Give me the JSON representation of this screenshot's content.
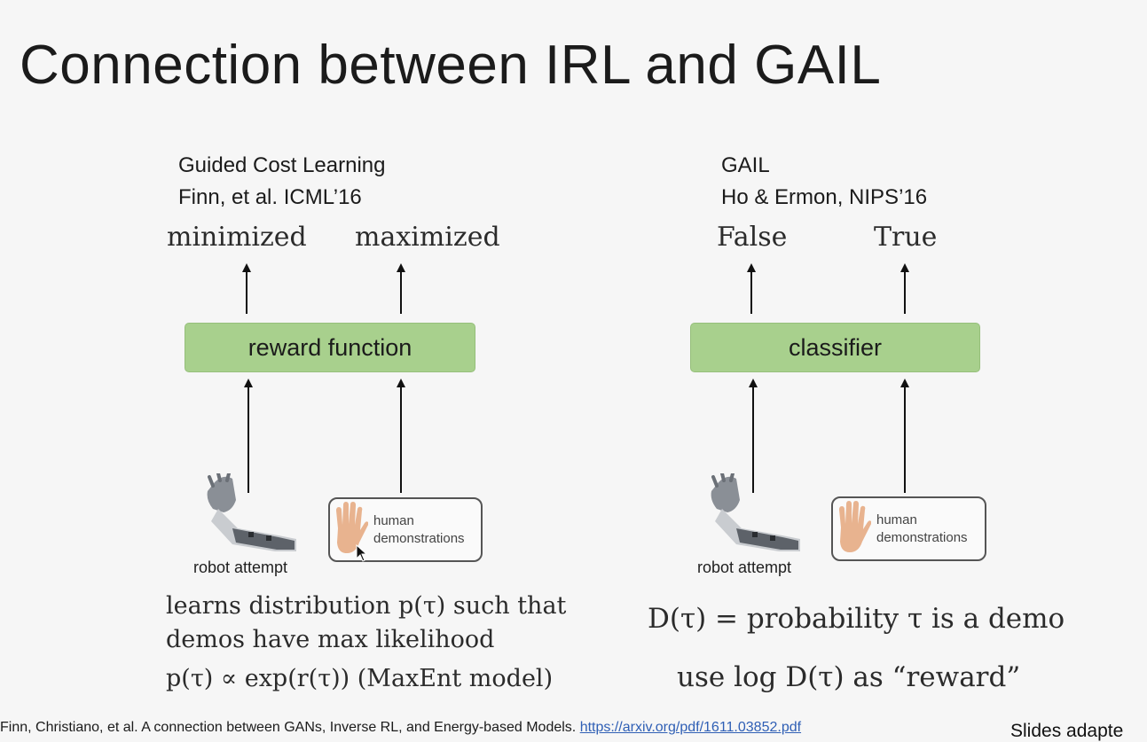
{
  "title": "Connection between IRL and GAIL",
  "left": {
    "head_line1": "Guided Cost Learning",
    "head_line2": "Finn, et al. ICML’16",
    "out_left": "minimized",
    "out_right": "maximized",
    "box_label": "reward function",
    "robot_caption": "robot attempt",
    "demo_line1": "human",
    "demo_line2": "demonstrations",
    "text_line1": "learns distribution p(τ) such that",
    "text_line2": "demos have max likelihood",
    "text_line3": "p(τ) ∝ exp(r(τ)) (MaxEnt model)"
  },
  "right": {
    "head_line1": "GAIL",
    "head_line2": "Ho & Ermon, NIPS’16",
    "out_left": "False",
    "out_right": "True",
    "box_label": "classifier",
    "robot_caption": "robot attempt",
    "demo_line1": "human",
    "demo_line2": "demonstrations",
    "text_line1": "D(τ) = probability τ is a demo",
    "text_line2": "use log D(τ) as “reward”"
  },
  "footer": {
    "citation": "Finn, Christiano, et al. A connection between GANs, Inverse RL, and Energy-based Models.",
    "link": "https://arxiv.org/pdf/1611.03852.pdf",
    "slides_credit": "Slides adapte"
  },
  "colors": {
    "box_fill": "#a8d08d",
    "link": "#2f5fb5",
    "background": "#f6f6f6"
  }
}
